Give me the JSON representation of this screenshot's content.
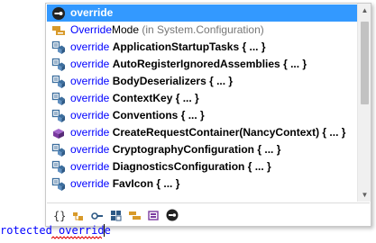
{
  "completion": {
    "items": [
      {
        "icon": "keyword-icon",
        "prefix": "",
        "highlight": "",
        "name": "override",
        "suffix": "",
        "selected": true
      },
      {
        "icon": "enum-value-icon",
        "prefix": "",
        "highlight": "Override",
        "name": "Mode",
        "suffix": " (in System.Configuration)",
        "selected": false
      },
      {
        "icon": "method-icon",
        "prefix": "override ",
        "highlight": "",
        "name": "ApplicationStartupTasks",
        "suffix": " { ... }",
        "selected": false
      },
      {
        "icon": "method-icon",
        "prefix": "override ",
        "highlight": "",
        "name": "AutoRegisterIgnoredAssemblies",
        "suffix": " { ... }",
        "selected": false
      },
      {
        "icon": "method-icon",
        "prefix": "override ",
        "highlight": "",
        "name": "BodyDeserializers",
        "suffix": " { ... }",
        "selected": false
      },
      {
        "icon": "method-icon",
        "prefix": "override ",
        "highlight": "",
        "name": "ContextKey",
        "suffix": " { ... }",
        "selected": false
      },
      {
        "icon": "method-icon",
        "prefix": "override ",
        "highlight": "",
        "name": "Conventions",
        "suffix": " { ... }",
        "selected": false
      },
      {
        "icon": "protected-method-icon",
        "prefix": "override ",
        "highlight": "",
        "name": "CreateRequestContainer(NancyContext)",
        "suffix": " { ... }",
        "selected": false
      },
      {
        "icon": "method-icon",
        "prefix": "override ",
        "highlight": "",
        "name": "CryptographyConfiguration",
        "suffix": " { ... }",
        "selected": false
      },
      {
        "icon": "method-icon",
        "prefix": "override ",
        "highlight": "",
        "name": "DiagnosticsConfiguration",
        "suffix": " { ... }",
        "selected": false
      },
      {
        "icon": "method-icon",
        "prefix": "override ",
        "highlight": "",
        "name": "FavIcon",
        "suffix": " { ... }",
        "selected": false
      }
    ],
    "filters": [
      "namespace-filter-icon",
      "class-filter-icon",
      "interface-filter-icon",
      "struct-filter-icon",
      "enum-filter-icon",
      "module-filter-icon",
      "keyword-filter-icon"
    ],
    "colors": {
      "selection": "#3399ff",
      "keyword": "#0000ff",
      "method_icon": "#3c6e9e",
      "enum_icon": "#d89a2a",
      "protected_icon": "#7b3aa0"
    }
  },
  "editor": {
    "line_text": "rotected override",
    "squiggle_color": "#e00000"
  }
}
